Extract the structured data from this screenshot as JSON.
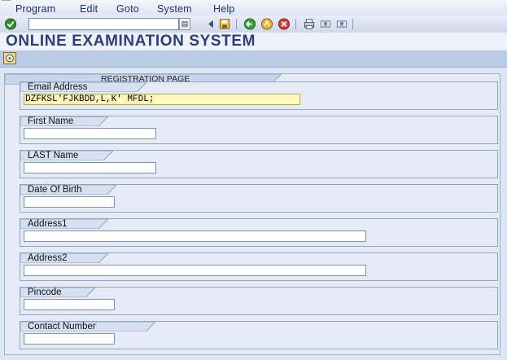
{
  "menu": {
    "items": [
      "Program",
      "Edit",
      "Goto",
      "System",
      "Help"
    ]
  },
  "page_title": "ONLINE EXAMINATION SYSTEM",
  "registration": {
    "tab_label": "REGISTRATION PAGE",
    "fields": {
      "email": {
        "label": "Email Address",
        "value": "DZFKSL'FJKBDD,L,K' MFDL;"
      },
      "first_name": {
        "label": "First Name",
        "value": ""
      },
      "last_name": {
        "label": "LAST Name",
        "value": ""
      },
      "dob": {
        "label": "Date Of Birth",
        "value": ""
      },
      "address1": {
        "label": "Address1",
        "value": ""
      },
      "address2": {
        "label": "Address2",
        "value": ""
      },
      "pincode": {
        "label": "Pincode",
        "value": ""
      },
      "contact": {
        "label": "Contact Number",
        "value": ""
      }
    }
  },
  "colors": {
    "title": "#2f3e7a",
    "app_toolbar": "#b9cbe7",
    "focused_field": "#fff9b8"
  },
  "icons": {
    "toolbar": [
      "enter-icon",
      "dropdown-arrow-icon",
      "back-nav-icon",
      "save-icon",
      "back-icon",
      "exit-icon",
      "cancel-icon",
      "print-icon",
      "find-icon",
      "find-next-icon"
    ],
    "app_toolbar": [
      "execute-icon"
    ]
  }
}
